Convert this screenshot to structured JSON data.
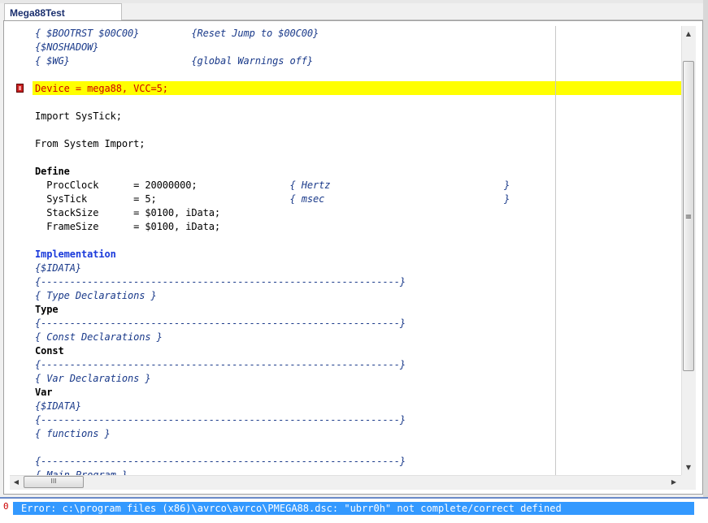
{
  "window": {
    "tab_title": "Mega88Test"
  },
  "editor": {
    "lines": [
      [
        {
          "t": "{ $BOOTRST $00C00}         {Reset Jump to $00C00}",
          "c": "comment"
        }
      ],
      [
        {
          "t": "{$NOSHADOW}",
          "c": "comment"
        }
      ],
      [
        {
          "t": "{ $WG}                     {global Warnings off}",
          "c": "comment"
        }
      ],
      [
        {
          "t": "",
          "c": ""
        }
      ],
      [
        {
          "t": "Device = mega88, VCC=5;",
          "c": "error"
        }
      ],
      [
        {
          "t": "",
          "c": ""
        }
      ],
      [
        {
          "t": "Import SysTick;",
          "c": ""
        }
      ],
      [
        {
          "t": "",
          "c": ""
        }
      ],
      [
        {
          "t": "From System Import;",
          "c": ""
        }
      ],
      [
        {
          "t": "",
          "c": ""
        }
      ],
      [
        {
          "t": "Define",
          "c": "kw"
        }
      ],
      [
        {
          "t": "  ProcClock      = 20000000;                ",
          "c": ""
        },
        {
          "t": "{ Hertz                              }",
          "c": "comment"
        }
      ],
      [
        {
          "t": "  SysTick        = 5;                       ",
          "c": ""
        },
        {
          "t": "{ msec                               }",
          "c": "comment"
        }
      ],
      [
        {
          "t": "  StackSize      = $0100, iData;",
          "c": ""
        }
      ],
      [
        {
          "t": "  FrameSize      = $0100, iData;",
          "c": ""
        }
      ],
      [
        {
          "t": "",
          "c": ""
        }
      ],
      [
        {
          "t": "Implementation",
          "c": "impl"
        }
      ],
      [
        {
          "t": "{$IDATA}",
          "c": "comment"
        }
      ],
      [
        {
          "t": "{--------------------------------------------------------------}",
          "c": "comment"
        }
      ],
      [
        {
          "t": "{ Type Declarations }",
          "c": "comment"
        }
      ],
      [
        {
          "t": "Type",
          "c": "kw"
        }
      ],
      [
        {
          "t": "{--------------------------------------------------------------}",
          "c": "comment"
        }
      ],
      [
        {
          "t": "{ Const Declarations }",
          "c": "comment"
        }
      ],
      [
        {
          "t": "Const",
          "c": "kw"
        }
      ],
      [
        {
          "t": "{--------------------------------------------------------------}",
          "c": "comment"
        }
      ],
      [
        {
          "t": "{ Var Declarations }",
          "c": "comment"
        }
      ],
      [
        {
          "t": "Var",
          "c": "kw"
        }
      ],
      [
        {
          "t": "{$IDATA}",
          "c": "comment"
        }
      ],
      [
        {
          "t": "{--------------------------------------------------------------}",
          "c": "comment"
        }
      ],
      [
        {
          "t": "{ functions }",
          "c": "comment"
        }
      ],
      [
        {
          "t": "",
          "c": ""
        }
      ],
      [
        {
          "t": "{--------------------------------------------------------------}",
          "c": "comment"
        }
      ],
      [
        {
          "t": "{ Main Program }",
          "c": "comment"
        }
      ]
    ],
    "highlighted_line": 5
  },
  "scrollbars": {
    "up_arrow": "▲",
    "down_arrow": "▼",
    "left_arrow": "◀",
    "right_arrow": "▶",
    "h_grip": "III",
    "v_grip": "≡"
  },
  "messages": {
    "error_count": "0",
    "error_text": "Error: c:\\program files (x86)\\avrco\\avrco\\PMEGA88.dsc: \"ubrr0h\" not complete/correct defined"
  },
  "colors": {
    "highlight": "#ffff00",
    "error_text": "#cc0000",
    "comment": "#1a3a8a",
    "implementation_keyword": "#1a3adb",
    "status_selection": "#3399ff"
  }
}
